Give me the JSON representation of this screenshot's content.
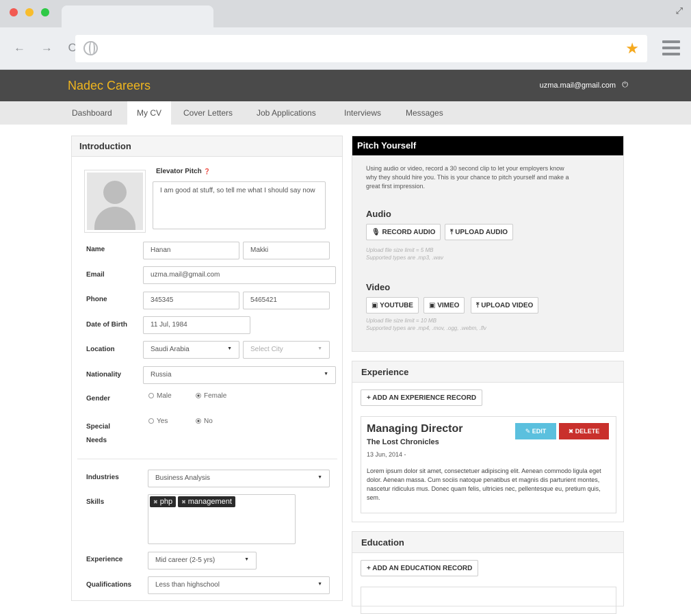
{
  "browser": {
    "nav_arrows": "← → C",
    "expand_glyph": "⤢",
    "star_glyph": "★"
  },
  "app": {
    "brand": "Nadec Careers",
    "user_email": "uzma.mail@gmail.com",
    "power_glyph": "⏻",
    "accent": "#f0b61e"
  },
  "nav": {
    "tabs": [
      "Dashboard",
      "My CV",
      "Cover Letters",
      "Job Applications",
      "Interviews",
      "Messages"
    ],
    "active": "My CV"
  },
  "intro": {
    "title": "Introduction",
    "pitch_label": "Elevator Pitch",
    "pitch_help": "❓",
    "pitch_value": "I am good at stuff, so tell me what I should say now",
    "labels": {
      "name": "Name",
      "email": "Email",
      "phone": "Phone",
      "dob": "Date of Birth",
      "location": "Location",
      "nationality": "Nationality",
      "gender": "Gender",
      "special_needs_1": "Special",
      "special_needs_2": "Needs",
      "industries": "Industries",
      "skills": "Skills",
      "experience": "Experience",
      "qualifications": "Qualifications"
    },
    "values": {
      "first_name": "Hanan",
      "last_name": "Makki",
      "email": "uzma.mail@gmail.com",
      "phone_1": "345345",
      "phone_2": "5465421",
      "dob": "11 Jul, 1984",
      "country": "Saudi Arabia",
      "city_placeholder": "Select City",
      "nationality": "Russia",
      "industries": "Business Analysis",
      "experience": "Mid career (2-5 yrs)",
      "qualifications": "Less than highschool"
    },
    "gender": {
      "male": "Male",
      "female": "Female",
      "selected": "Female"
    },
    "special": {
      "yes": "Yes",
      "no": "No",
      "selected": "No"
    },
    "skills": [
      "php",
      "management"
    ]
  },
  "pitch": {
    "title": "Pitch Yourself",
    "description": "Using audio or video, record a 30 second clip to let your employers know why they should hire you. This is your chance to pitch yourself and make a great first impression.",
    "audio_heading": "Audio",
    "record_audio": "RECORD AUDIO",
    "upload_audio": "UPLOAD AUDIO",
    "audio_note_1": "Upload file size limit = 5 MB",
    "audio_note_2": "Supported types are .mp3, .wav",
    "video_heading": "Video",
    "youtube": "YOUTUBE",
    "vimeo": "VIMEO",
    "upload_video": "UPLOAD VIDEO",
    "video_note_1": "Upload file size limit = 10 MB",
    "video_note_2": "Supported types are .mp4, .mov, .ogg, .webm, .flv"
  },
  "experience": {
    "title": "Experience",
    "add_label": "ADD AN EXPERIENCE RECORD",
    "record": {
      "role": "Managing Director",
      "company": "The Lost Chronicles",
      "dates": "13 Jun, 2014 -",
      "description": "Lorem ipsum dolor sit amet, consectetuer adipiscing elit. Aenean commodo ligula eget dolor. Aenean massa. Cum sociis natoque penatibus et magnis dis parturient montes, nascetur ridiculus mus. Donec quam felis, ultricies nec, pellentesque eu, pretium quis, sem.",
      "edit": "EDIT",
      "delete": "DELETE"
    }
  },
  "education": {
    "title": "Education",
    "add_label": "ADD AN EDUCATION RECORD"
  }
}
